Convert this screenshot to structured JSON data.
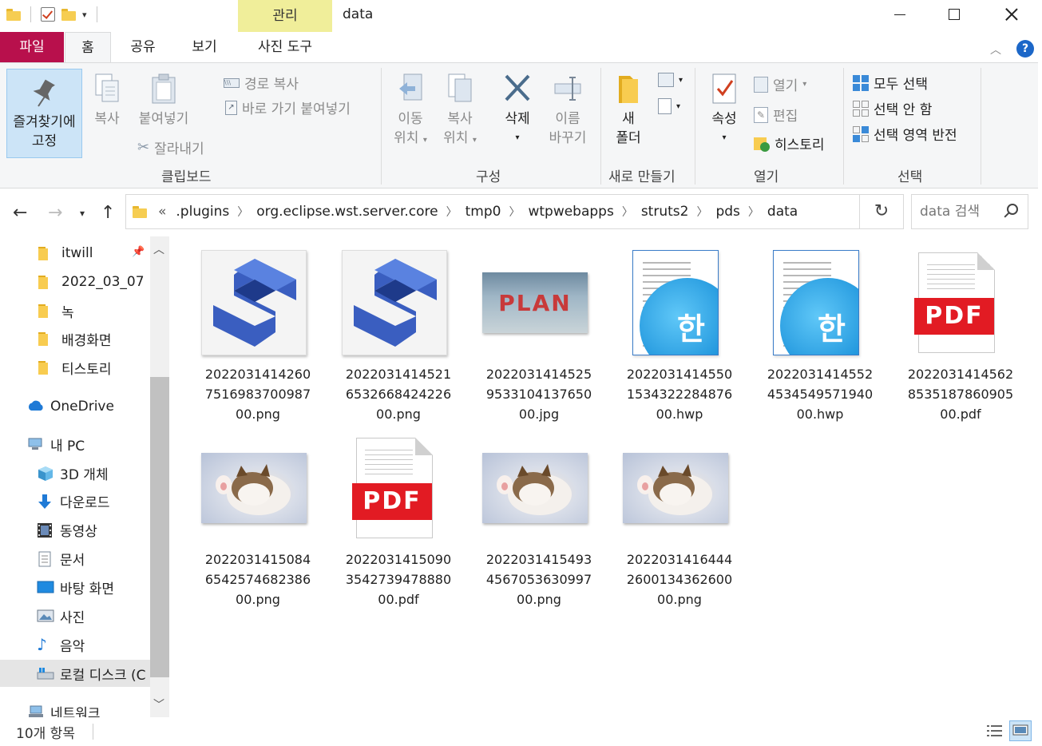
{
  "window": {
    "title": "data",
    "manage_tab": "관리",
    "colors": {
      "file_tab": "#b8104c",
      "manage_tab": "#f0ee9a",
      "selection": "#cce4f7"
    }
  },
  "tabs": {
    "file": "파일",
    "home": "홈",
    "share": "공유",
    "view": "보기",
    "photo_tools": "사진 도구"
  },
  "ribbon": {
    "clipboard": {
      "label": "클립보드",
      "pin": "즐겨찾기에\n고정",
      "pin_line1": "즐겨찾기에",
      "pin_line2": "고정",
      "copy": "복사",
      "paste": "붙여넣기",
      "copy_path": "경로 복사",
      "paste_shortcut": "바로 가기 붙여넣기",
      "cut": "잘라내기"
    },
    "organize": {
      "label": "구성",
      "move_line1": "이동",
      "move_line2": "위치",
      "copy_line1": "복사",
      "copy_line2": "위치",
      "delete": "삭제",
      "rename_line1": "이름",
      "rename_line2": "바꾸기"
    },
    "new": {
      "label": "새로 만들기",
      "folder_line1": "새",
      "folder_line2": "폴더"
    },
    "open": {
      "label": "열기",
      "properties": "속성",
      "open": "열기",
      "edit": "편집",
      "history": "히스토리"
    },
    "select": {
      "label": "선택",
      "select_all": "모두 선택",
      "select_none": "선택 안 함",
      "invert": "선택 영역 반전"
    }
  },
  "address": {
    "overflow": "«",
    "segments": [
      ".plugins",
      "org.eclipse.wst.server.core",
      "tmp0",
      "wtpwebapps",
      "struts2",
      "pds",
      "data"
    ],
    "search_placeholder": "data 검색"
  },
  "sidebar": {
    "items": [
      {
        "label": "itwill",
        "icon": "folder-icon",
        "pinned": true
      },
      {
        "label": "2022_03_07",
        "icon": "folder-icon"
      },
      {
        "label": "녹",
        "icon": "folder-icon"
      },
      {
        "label": "배경화면",
        "icon": "folder-icon"
      },
      {
        "label": "티스토리",
        "icon": "folder-icon"
      },
      {
        "label": "OneDrive",
        "icon": "cloud-icon"
      },
      {
        "label": "내 PC",
        "icon": "computer-icon"
      },
      {
        "label": "3D 개체",
        "icon": "cube-icon"
      },
      {
        "label": "다운로드",
        "icon": "download-icon"
      },
      {
        "label": "동영상",
        "icon": "video-icon"
      },
      {
        "label": "문서",
        "icon": "document-icon"
      },
      {
        "label": "바탕 화면",
        "icon": "desktop-icon"
      },
      {
        "label": "사진",
        "icon": "picture-icon"
      },
      {
        "label": "음악",
        "icon": "music-icon"
      },
      {
        "label": "로컬 디스크 (C",
        "icon": "disk-icon",
        "selected": true
      },
      {
        "label": "네트워크",
        "icon": "network-icon"
      }
    ]
  },
  "files": [
    {
      "name": "20220314142607516983700987​00.png",
      "line1": "2022031414260",
      "line2": "7516983700987",
      "line3": "00.png",
      "kind": "logo"
    },
    {
      "name": "2022031414521653266842422600.png",
      "line1": "2022031414521",
      "line2": "6532668424226",
      "line3": "00.png",
      "kind": "logo"
    },
    {
      "name": "2022031414525953310413765000.jpg",
      "line1": "2022031414525",
      "line2": "9533104137650",
      "line3": "00.jpg",
      "kind": "plan"
    },
    {
      "name": "2022031414550153432228487600.hwp",
      "line1": "2022031414550",
      "line2": "1534322284876",
      "line3": "00.hwp",
      "kind": "hwp"
    },
    {
      "name": "2022031414552453454957194000.hwp",
      "line1": "2022031414552",
      "line2": "4534549571940",
      "line3": "00.hwp",
      "kind": "hwp"
    },
    {
      "name": "2022031414562853518786090500.pdf",
      "line1": "2022031414562",
      "line2": "8535187860905",
      "line3": "00.pdf",
      "kind": "pdf"
    },
    {
      "name": "2022031415084654257468238600.png",
      "line1": "2022031415084",
      "line2": "6542574682386",
      "line3": "00.png",
      "kind": "cat"
    },
    {
      "name": "2022031415090354273947888000.pdf",
      "line1": "2022031415090",
      "line2": "3542739478880",
      "line3": "00.pdf",
      "kind": "pdf"
    },
    {
      "name": "2022031415493456705363099700.png",
      "line1": "2022031415493",
      "line2": "4567053630997",
      "line3": "00.png",
      "kind": "cat"
    },
    {
      "name": "2022031416444260013436260000.png",
      "line1": "2022031416444",
      "line2": "2600134362600",
      "line3": "00.png",
      "kind": "cat"
    }
  ],
  "thumb_text": {
    "plan": "PLAN",
    "pdf": "PDF",
    "hwp": "한"
  },
  "status": {
    "count": "10개 항목"
  }
}
